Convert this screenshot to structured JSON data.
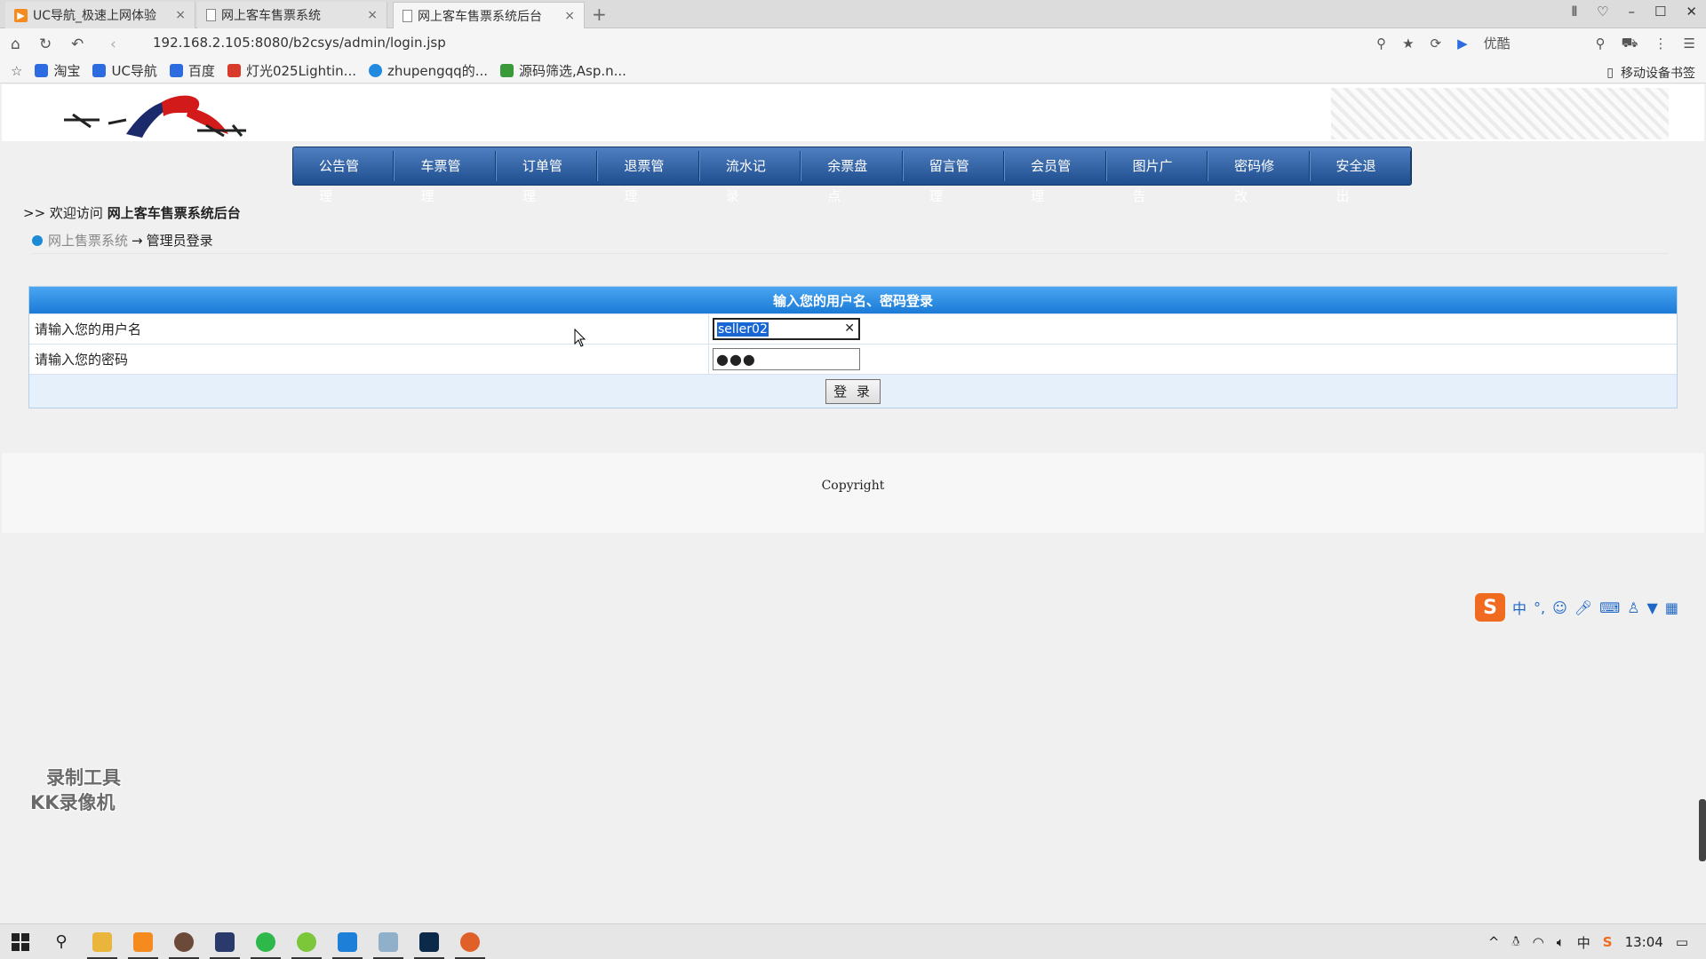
{
  "browser": {
    "tabs": [
      {
        "label": "UC导航_极速上网体验",
        "active": false
      },
      {
        "label": "网上客车售票系统",
        "active": false
      },
      {
        "label": "网上客车售票系统后台",
        "active": true
      }
    ],
    "new_tab": "+",
    "url": "192.168.2.105:8080/b2csys/admin/login.jsp",
    "search_label": "优酷",
    "bookmarks": [
      {
        "label": "淘宝",
        "color": "#2d6be0"
      },
      {
        "label": "UC导航",
        "color": "#2d6be0"
      },
      {
        "label": "百度",
        "color": "#2d6be0"
      },
      {
        "label": "灯光025Lightin...",
        "color": "#d83a2c"
      },
      {
        "label": "zhupengqq的...",
        "color": "#1f8ae0"
      },
      {
        "label": "源码筛选,Asp.n...",
        "color": "#3a9a3a"
      }
    ],
    "mobile_bookmarks": "移动设备书签"
  },
  "page": {
    "menu": [
      "公告管理",
      "车票管理",
      "订单管理",
      "退票管理",
      "流水记录",
      "余票盘点",
      "留言管理",
      "会员管理",
      "图片广告",
      "密码修改",
      "安全退出"
    ],
    "welcome_prefix": ">> 欢迎访问",
    "welcome_site": "网上客车售票系统后台",
    "breadcrumb": {
      "link": "网上售票系统",
      "arrow": "→",
      "current": "管理员登录"
    },
    "login": {
      "heading": "输入您的用户名、密码登录",
      "username_label": "请输入您的用户名",
      "username_value": "seller02",
      "password_label": "请输入您的密码",
      "password_mask": "●●●",
      "submit_label": "登 录"
    },
    "copyright": "Copyright"
  },
  "overlay": {
    "watermark_line1": "录制工具",
    "watermark_line2": "KK录像机",
    "ime_lang": "中"
  },
  "taskbar": {
    "clock": "13:04",
    "ime_indicator": "中"
  },
  "colors": {
    "menu_bar": "#2a5c9f",
    "login_header": "#2b8ce6",
    "selection": "#1866d3"
  }
}
